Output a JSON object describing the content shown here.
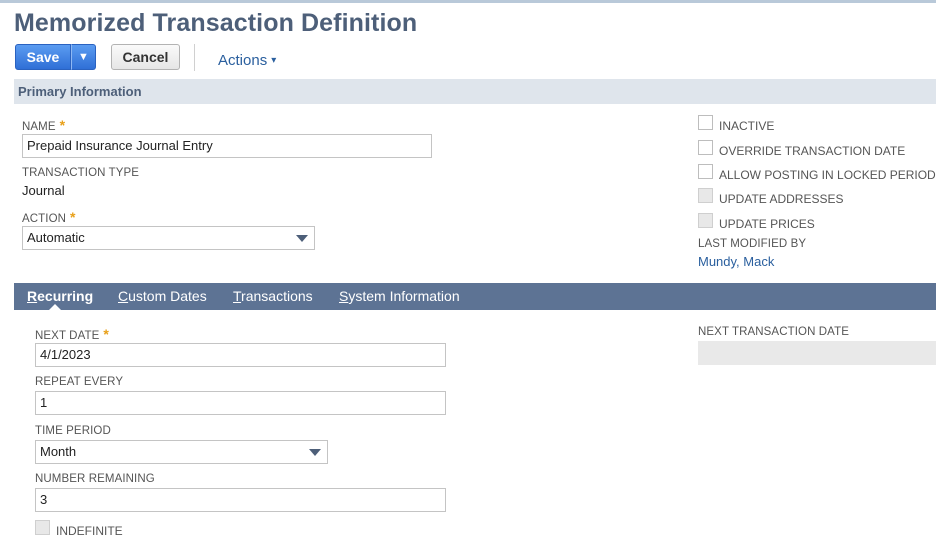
{
  "page": {
    "title": "Memorized Transaction Definition"
  },
  "toolbar": {
    "save_label": "Save",
    "save_arrow": "▼",
    "cancel_label": "Cancel",
    "actions_label": "Actions",
    "actions_caret": "▾"
  },
  "section": {
    "title": "Primary Information"
  },
  "fields": {
    "name": {
      "label": "NAME",
      "required": "*",
      "value": "Prepaid Insurance Journal Entry"
    },
    "transaction_type": {
      "label": "TRANSACTION TYPE",
      "value": "Journal"
    },
    "action": {
      "label": "ACTION",
      "required": "*",
      "value": "Automatic"
    }
  },
  "checkboxes": [
    {
      "label": "INACTIVE",
      "checked": false,
      "disabled": false
    },
    {
      "label": "OVERRIDE TRANSACTION DATE",
      "checked": false,
      "disabled": false
    },
    {
      "label": "ALLOW POSTING IN LOCKED PERIOD",
      "checked": false,
      "disabled": false
    },
    {
      "label": "UPDATE ADDRESSES",
      "checked": false,
      "disabled": true
    },
    {
      "label": "UPDATE PRICES",
      "checked": false,
      "disabled": true
    }
  ],
  "last_modified": {
    "label": "LAST MODIFIED BY",
    "value": "Mundy, Mack"
  },
  "tabs": [
    {
      "first": "R",
      "rest": "ecurring",
      "active": true
    },
    {
      "first": "C",
      "rest": "ustom Dates",
      "active": false
    },
    {
      "first": "T",
      "rest": "ransactions",
      "active": false
    },
    {
      "first": "S",
      "rest": "ystem Information",
      "active": false
    }
  ],
  "recurring": {
    "next_date": {
      "label": "NEXT DATE",
      "required": "*",
      "value": "4/1/2023"
    },
    "repeat_every": {
      "label": "REPEAT EVERY",
      "value": "1"
    },
    "time_period": {
      "label": "TIME PERIOD",
      "value": "Month"
    },
    "number_remaining": {
      "label": "NUMBER REMAINING",
      "value": "3"
    },
    "indefinite": {
      "label": "INDEFINITE",
      "checked": false,
      "disabled": true
    },
    "next_transaction_date": {
      "label": "NEXT TRANSACTION DATE",
      "value": ""
    }
  },
  "colors": {
    "accent": "#2f6fd6",
    "header_text": "#4d5f79",
    "tab_bar": "#5d7394",
    "link": "#2a5f9e",
    "required": "#e8a019"
  }
}
